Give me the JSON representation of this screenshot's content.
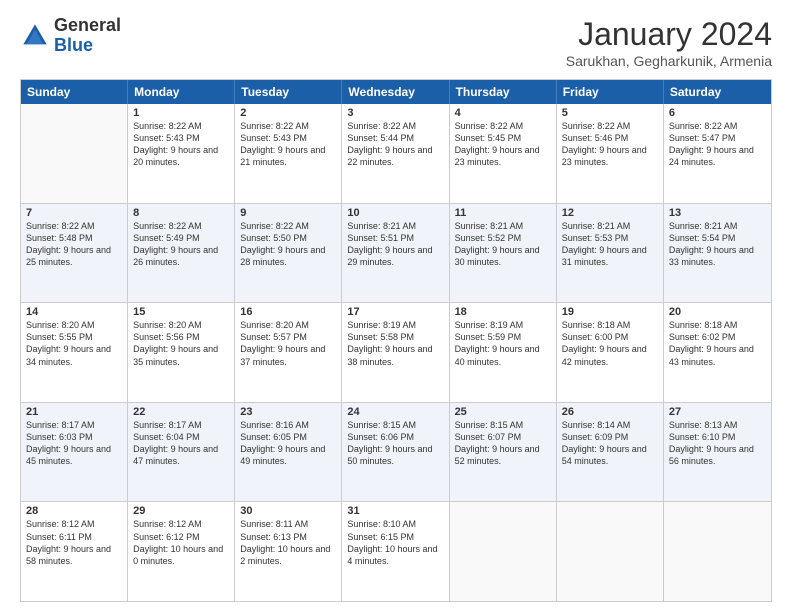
{
  "header": {
    "logo_general": "General",
    "logo_blue": "Blue",
    "month_title": "January 2024",
    "location": "Sarukhan, Gegharkunik, Armenia"
  },
  "weekdays": [
    "Sunday",
    "Monday",
    "Tuesday",
    "Wednesday",
    "Thursday",
    "Friday",
    "Saturday"
  ],
  "weeks": [
    [
      {
        "day": "",
        "sunrise": "",
        "sunset": "",
        "daylight": "",
        "empty": true
      },
      {
        "day": "1",
        "sunrise": "Sunrise: 8:22 AM",
        "sunset": "Sunset: 5:43 PM",
        "daylight": "Daylight: 9 hours and 20 minutes."
      },
      {
        "day": "2",
        "sunrise": "Sunrise: 8:22 AM",
        "sunset": "Sunset: 5:43 PM",
        "daylight": "Daylight: 9 hours and 21 minutes."
      },
      {
        "day": "3",
        "sunrise": "Sunrise: 8:22 AM",
        "sunset": "Sunset: 5:44 PM",
        "daylight": "Daylight: 9 hours and 22 minutes."
      },
      {
        "day": "4",
        "sunrise": "Sunrise: 8:22 AM",
        "sunset": "Sunset: 5:45 PM",
        "daylight": "Daylight: 9 hours and 23 minutes."
      },
      {
        "day": "5",
        "sunrise": "Sunrise: 8:22 AM",
        "sunset": "Sunset: 5:46 PM",
        "daylight": "Daylight: 9 hours and 23 minutes."
      },
      {
        "day": "6",
        "sunrise": "Sunrise: 8:22 AM",
        "sunset": "Sunset: 5:47 PM",
        "daylight": "Daylight: 9 hours and 24 minutes."
      }
    ],
    [
      {
        "day": "7",
        "sunrise": "Sunrise: 8:22 AM",
        "sunset": "Sunset: 5:48 PM",
        "daylight": "Daylight: 9 hours and 25 minutes."
      },
      {
        "day": "8",
        "sunrise": "Sunrise: 8:22 AM",
        "sunset": "Sunset: 5:49 PM",
        "daylight": "Daylight: 9 hours and 26 minutes."
      },
      {
        "day": "9",
        "sunrise": "Sunrise: 8:22 AM",
        "sunset": "Sunset: 5:50 PM",
        "daylight": "Daylight: 9 hours and 28 minutes."
      },
      {
        "day": "10",
        "sunrise": "Sunrise: 8:21 AM",
        "sunset": "Sunset: 5:51 PM",
        "daylight": "Daylight: 9 hours and 29 minutes."
      },
      {
        "day": "11",
        "sunrise": "Sunrise: 8:21 AM",
        "sunset": "Sunset: 5:52 PM",
        "daylight": "Daylight: 9 hours and 30 minutes."
      },
      {
        "day": "12",
        "sunrise": "Sunrise: 8:21 AM",
        "sunset": "Sunset: 5:53 PM",
        "daylight": "Daylight: 9 hours and 31 minutes."
      },
      {
        "day": "13",
        "sunrise": "Sunrise: 8:21 AM",
        "sunset": "Sunset: 5:54 PM",
        "daylight": "Daylight: 9 hours and 33 minutes."
      }
    ],
    [
      {
        "day": "14",
        "sunrise": "Sunrise: 8:20 AM",
        "sunset": "Sunset: 5:55 PM",
        "daylight": "Daylight: 9 hours and 34 minutes."
      },
      {
        "day": "15",
        "sunrise": "Sunrise: 8:20 AM",
        "sunset": "Sunset: 5:56 PM",
        "daylight": "Daylight: 9 hours and 35 minutes."
      },
      {
        "day": "16",
        "sunrise": "Sunrise: 8:20 AM",
        "sunset": "Sunset: 5:57 PM",
        "daylight": "Daylight: 9 hours and 37 minutes."
      },
      {
        "day": "17",
        "sunrise": "Sunrise: 8:19 AM",
        "sunset": "Sunset: 5:58 PM",
        "daylight": "Daylight: 9 hours and 38 minutes."
      },
      {
        "day": "18",
        "sunrise": "Sunrise: 8:19 AM",
        "sunset": "Sunset: 5:59 PM",
        "daylight": "Daylight: 9 hours and 40 minutes."
      },
      {
        "day": "19",
        "sunrise": "Sunrise: 8:18 AM",
        "sunset": "Sunset: 6:00 PM",
        "daylight": "Daylight: 9 hours and 42 minutes."
      },
      {
        "day": "20",
        "sunrise": "Sunrise: 8:18 AM",
        "sunset": "Sunset: 6:02 PM",
        "daylight": "Daylight: 9 hours and 43 minutes."
      }
    ],
    [
      {
        "day": "21",
        "sunrise": "Sunrise: 8:17 AM",
        "sunset": "Sunset: 6:03 PM",
        "daylight": "Daylight: 9 hours and 45 minutes."
      },
      {
        "day": "22",
        "sunrise": "Sunrise: 8:17 AM",
        "sunset": "Sunset: 6:04 PM",
        "daylight": "Daylight: 9 hours and 47 minutes."
      },
      {
        "day": "23",
        "sunrise": "Sunrise: 8:16 AM",
        "sunset": "Sunset: 6:05 PM",
        "daylight": "Daylight: 9 hours and 49 minutes."
      },
      {
        "day": "24",
        "sunrise": "Sunrise: 8:15 AM",
        "sunset": "Sunset: 6:06 PM",
        "daylight": "Daylight: 9 hours and 50 minutes."
      },
      {
        "day": "25",
        "sunrise": "Sunrise: 8:15 AM",
        "sunset": "Sunset: 6:07 PM",
        "daylight": "Daylight: 9 hours and 52 minutes."
      },
      {
        "day": "26",
        "sunrise": "Sunrise: 8:14 AM",
        "sunset": "Sunset: 6:09 PM",
        "daylight": "Daylight: 9 hours and 54 minutes."
      },
      {
        "day": "27",
        "sunrise": "Sunrise: 8:13 AM",
        "sunset": "Sunset: 6:10 PM",
        "daylight": "Daylight: 9 hours and 56 minutes."
      }
    ],
    [
      {
        "day": "28",
        "sunrise": "Sunrise: 8:12 AM",
        "sunset": "Sunset: 6:11 PM",
        "daylight": "Daylight: 9 hours and 58 minutes."
      },
      {
        "day": "29",
        "sunrise": "Sunrise: 8:12 AM",
        "sunset": "Sunset: 6:12 PM",
        "daylight": "Daylight: 10 hours and 0 minutes."
      },
      {
        "day": "30",
        "sunrise": "Sunrise: 8:11 AM",
        "sunset": "Sunset: 6:13 PM",
        "daylight": "Daylight: 10 hours and 2 minutes."
      },
      {
        "day": "31",
        "sunrise": "Sunrise: 8:10 AM",
        "sunset": "Sunset: 6:15 PM",
        "daylight": "Daylight: 10 hours and 4 minutes."
      },
      {
        "day": "",
        "sunrise": "",
        "sunset": "",
        "daylight": "",
        "empty": true
      },
      {
        "day": "",
        "sunrise": "",
        "sunset": "",
        "daylight": "",
        "empty": true
      },
      {
        "day": "",
        "sunrise": "",
        "sunset": "",
        "daylight": "",
        "empty": true
      }
    ]
  ]
}
